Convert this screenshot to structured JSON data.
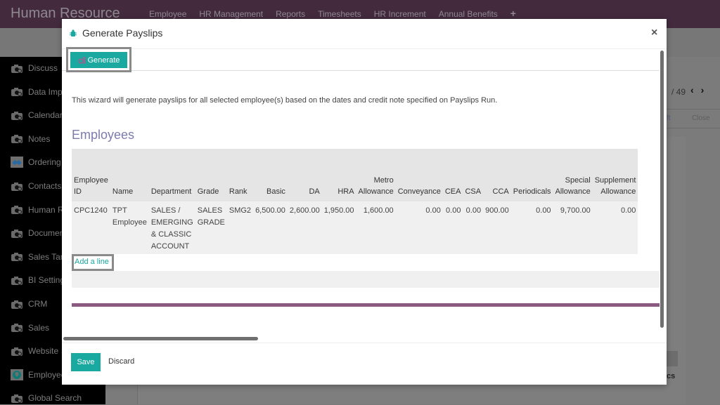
{
  "app": {
    "title": "Human Resource",
    "menu": [
      "Employee",
      "HR Management",
      "Reports",
      "Timesheets",
      "HR Increment",
      "Annual Benefits"
    ],
    "add_icon": "+"
  },
  "sidebar": {
    "items": [
      {
        "label": "Discuss",
        "icon": "camera-icon"
      },
      {
        "label": "Data Imp",
        "icon": "camera-icon"
      },
      {
        "label": "Calendar",
        "icon": "camera-icon"
      },
      {
        "label": "Notes",
        "icon": "camera-icon"
      },
      {
        "label": "Ordering",
        "icon": "handshake-icon"
      },
      {
        "label": "Contacts",
        "icon": "camera-icon"
      },
      {
        "label": "Human R",
        "icon": "camera-icon"
      },
      {
        "label": "Documen",
        "icon": "camera-icon"
      },
      {
        "label": "Sales Tar",
        "icon": "camera-icon"
      },
      {
        "label": "BI Setting",
        "icon": "camera-icon"
      },
      {
        "label": "CRM",
        "icon": "camera-icon"
      },
      {
        "label": "Sales",
        "icon": "camera-icon"
      },
      {
        "label": "Website",
        "icon": "camera-icon"
      },
      {
        "label": "Employee",
        "icon": "map-pin-icon"
      },
      {
        "label": "Global Search",
        "icon": "camera-icon"
      }
    ]
  },
  "background": {
    "pager": "/ 49",
    "prev": "‹",
    "next": "›",
    "status_draft": "ft",
    "status_close": "Close",
    "partial_label": "cs"
  },
  "modal": {
    "title": "Generate Payslips",
    "close": "×",
    "generate_label": "Generate",
    "wizard_text": "This wizard will generate payslips for all selected employee(s) based on the dates and credit note specified on Payslips Run.",
    "section_title": "Employees",
    "table": {
      "columns": [
        {
          "line1": "Employee",
          "line2": "ID",
          "align": "left"
        },
        {
          "line1": "",
          "line2": "Name",
          "align": "left"
        },
        {
          "line1": "",
          "line2": "Department",
          "align": "left"
        },
        {
          "line1": "",
          "line2": "Grade",
          "align": "left"
        },
        {
          "line1": "",
          "line2": "Rank",
          "align": "left"
        },
        {
          "line1": "",
          "line2": "Basic",
          "align": "right"
        },
        {
          "line1": "",
          "line2": "DA",
          "align": "right"
        },
        {
          "line1": "",
          "line2": "HRA",
          "align": "right"
        },
        {
          "line1": "Metro",
          "line2": "Allowance",
          "align": "right"
        },
        {
          "line1": "",
          "line2": "Conveyance",
          "align": "right"
        },
        {
          "line1": "",
          "line2": "CEA",
          "align": "right"
        },
        {
          "line1": "",
          "line2": "CSA",
          "align": "right"
        },
        {
          "line1": "",
          "line2": "CCA",
          "align": "right"
        },
        {
          "line1": "",
          "line2": "Periodicals",
          "align": "right"
        },
        {
          "line1": "Special",
          "line2": "Allowance",
          "align": "right"
        },
        {
          "line1": "Supplement",
          "line2": "Allowance",
          "align": "right"
        }
      ],
      "rows": [
        {
          "cells": [
            [
              "CPC1240"
            ],
            [
              "TPT",
              "Employee"
            ],
            [
              "SALES /",
              "EMERGING",
              "& CLASSIC",
              "ACCOUNT"
            ],
            [
              "SALES",
              "GRADE"
            ],
            [
              "SMG2"
            ],
            [
              "6,500.00"
            ],
            [
              "2,600.00"
            ],
            [
              "1,950.00"
            ],
            [
              "1,600.00"
            ],
            [
              "0.00"
            ],
            [
              "0.00"
            ],
            [
              "0.00"
            ],
            [
              "900.00"
            ],
            [
              "0.00"
            ],
            [
              "9,700.00"
            ],
            [
              "0.00"
            ]
          ]
        }
      ]
    },
    "add_line": "Add a line",
    "save_label": "Save",
    "discard_label": "Discard"
  },
  "colors": {
    "topbar": "#432b3d",
    "accent": "#1aa9a0",
    "section_title": "#7c7bad",
    "divider": "#8c5a80"
  }
}
